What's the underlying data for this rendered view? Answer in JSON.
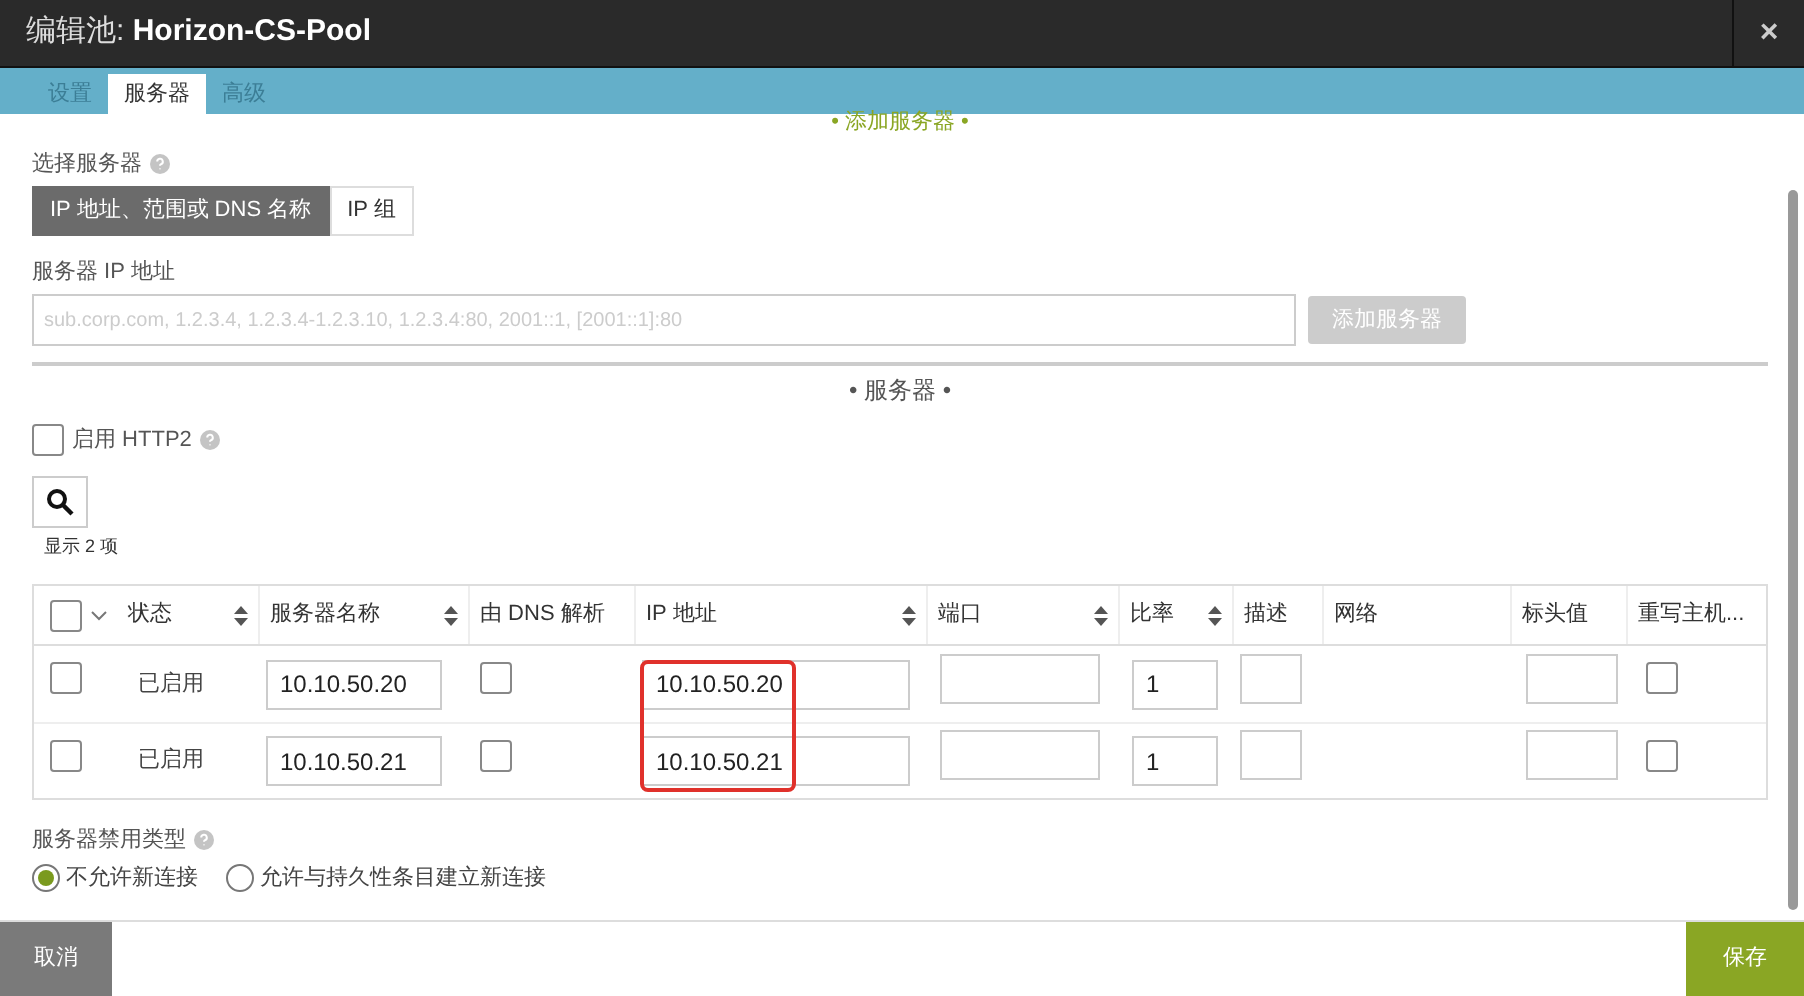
{
  "window": {
    "title_prefix": "编辑池: ",
    "title": "Horizon-CS-Pool",
    "close": "×"
  },
  "tabs": [
    {
      "label": "设置",
      "selected": false
    },
    {
      "label": "服务器",
      "selected": true
    },
    {
      "label": "高级",
      "selected": false
    }
  ],
  "add_section_heading": "• 添加服务器 •",
  "select_server": {
    "label": "选择服务器",
    "options": [
      {
        "label": "IP 地址、范围或 DNS 名称",
        "selected": true
      },
      {
        "label": "IP 组",
        "selected": false
      }
    ]
  },
  "server_ip": {
    "label": "服务器 IP 地址",
    "placeholder": "sub.corp.com, 1.2.3.4, 1.2.3.4-1.2.3.10, 1.2.3.4:80, 2001::1, [2001::1]:80",
    "button": "添加服务器"
  },
  "servers_heading": "• 服务器 •",
  "http2": {
    "label": "启用 HTTP2",
    "checked": false
  },
  "count": "显示 2 项",
  "table": {
    "select_all": false,
    "ip_highlight": true,
    "columns": [
      {
        "label": "状态",
        "sortable": true
      },
      {
        "label": "服务器名称",
        "sortable": true
      },
      {
        "label": "由 DNS 解析",
        "sortable": false
      },
      {
        "label": "IP 地址",
        "sortable": true
      },
      {
        "label": "端口",
        "sortable": true
      },
      {
        "label": "比率",
        "sortable": true
      },
      {
        "label": "描述",
        "sortable": false
      },
      {
        "label": "网络",
        "sortable": false
      },
      {
        "label": "标头值",
        "sortable": false
      },
      {
        "label": "重写主机...",
        "sortable": false
      }
    ],
    "rows": [
      {
        "selected": false,
        "status": "已启用",
        "name": "10.10.50.20",
        "dns": false,
        "ip": "10.10.50.20",
        "ratio": "1",
        "rewrite": false
      },
      {
        "selected": false,
        "status": "已启用",
        "name": "10.10.50.21",
        "dns": false,
        "ip": "10.10.50.21",
        "ratio": "1",
        "rewrite": false
      }
    ]
  },
  "disable_type": {
    "label": "服务器禁用类型",
    "options": [
      {
        "label": "不允许新连接",
        "selected": true
      },
      {
        "label": "允许与持久性条目建立新连接",
        "selected": false
      }
    ]
  },
  "footer": {
    "cancel": "取消",
    "save": "保存"
  }
}
